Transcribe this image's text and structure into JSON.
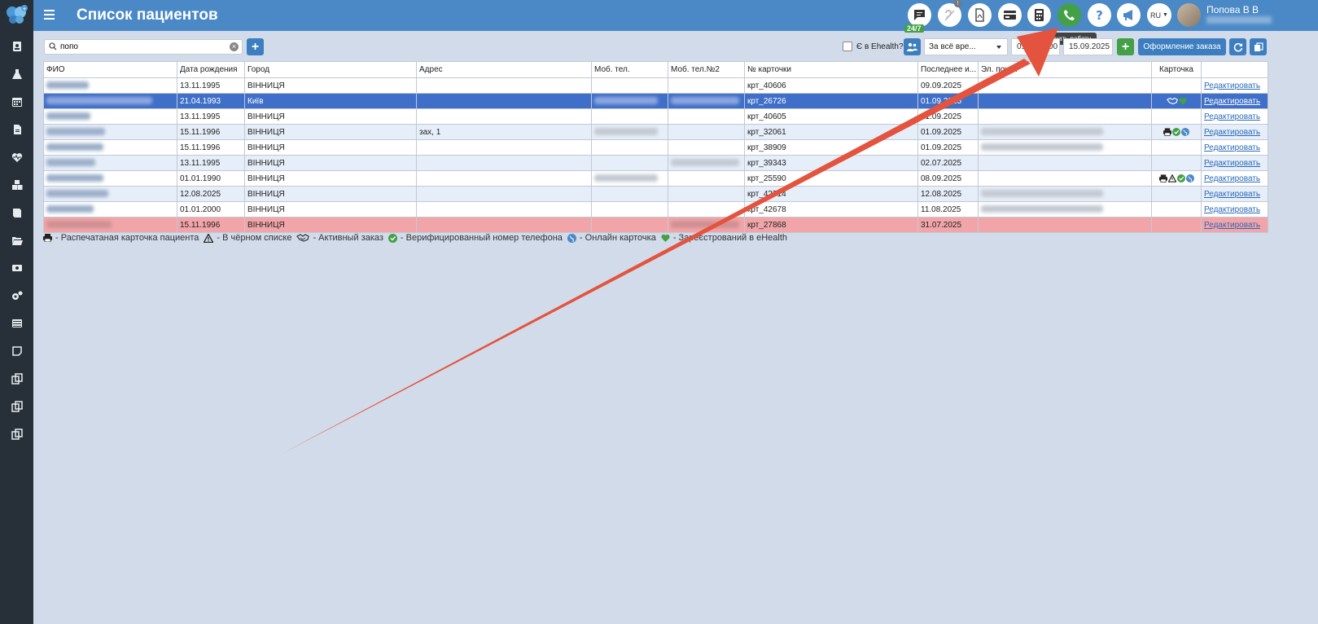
{
  "header": {
    "title": "Список пациентов",
    "badge_247": "24/7",
    "notification_dot": "!",
    "lang": "RU",
    "user_name": "Попова В В",
    "tooltip": "Начать работу"
  },
  "toolbar": {
    "search_value": "попо",
    "ehealth_label": "Є в Ehealth?",
    "period": "За всё вре...",
    "date_from": "01.01.1900",
    "date_to": "15.09.2025",
    "order_button": "Оформление заказа"
  },
  "table": {
    "columns": [
      "ФИО",
      "Дата рождения",
      "Город",
      "Адрес",
      "Моб. тел.",
      "Моб. тел.№2",
      "№ карточки",
      "Последнее и...",
      "Эл. почта",
      "Карточка",
      ""
    ],
    "edit_label": "Редактировать",
    "rows": [
      {
        "dob": "13.11.1995",
        "city": "ВІННИЦЯ",
        "address": "",
        "card": "крт_40606",
        "last": "09.09.2025",
        "icons": []
      },
      {
        "dob": "21.04.1993",
        "city": "Київ",
        "address": "",
        "card": "крт_26726",
        "last": "01.09.2025",
        "icons": [
          "order",
          "ehealth"
        ]
      },
      {
        "dob": "13.11.1995",
        "city": "ВІННИЦЯ",
        "address": "",
        "card": "крт_40605",
        "last": "01.09.2025",
        "icons": []
      },
      {
        "dob": "15.11.1996",
        "city": "ВІННИЦЯ",
        "address": "зах, 1",
        "card": "крт_32061",
        "last": "01.09.2025",
        "icons": [
          "print",
          "verified",
          "online"
        ]
      },
      {
        "dob": "15.11.1996",
        "city": "ВІННИЦЯ",
        "address": "",
        "card": "крт_38909",
        "last": "01.09.2025",
        "icons": []
      },
      {
        "dob": "13.11.1995",
        "city": "ВІННИЦЯ",
        "address": "",
        "card": "крт_39343",
        "last": "02.07.2025",
        "icons": []
      },
      {
        "dob": "01.01.1990",
        "city": "ВІННИЦЯ",
        "address": "",
        "card": "крт_25590",
        "last": "08.09.2025",
        "icons": [
          "print",
          "blacklist",
          "verified",
          "online"
        ]
      },
      {
        "dob": "12.08.2025",
        "city": "ВІННИЦЯ",
        "address": "",
        "card": "крт_42714",
        "last": "12.08.2025",
        "icons": []
      },
      {
        "dob": "01.01.2000",
        "city": "ВІННИЦЯ",
        "address": "",
        "card": "крт_42678",
        "last": "11.08.2025",
        "icons": []
      },
      {
        "dob": "15.11.1996",
        "city": "ВІННИЦЯ",
        "address": "",
        "card": "крт_27868",
        "last": "31.07.2025",
        "icons": []
      }
    ]
  },
  "legend": {
    "print": "- Распечатаная карточка пациента",
    "blacklist": "- В чёрном списке",
    "order": "- Активный заказ",
    "verified": "- Верифицированный номер телефона",
    "online": "- Онлайн карточка",
    "ehealth": "- Зареєстрований в eHealth"
  },
  "colors": {
    "header": "#4b89c6",
    "sidebar": "#273039",
    "background": "#d1dbea",
    "selected_row": "#3f6fc8",
    "blacklist_row": "#f2a5a8",
    "accent_green": "#43a047",
    "annotation_arrow": "#e4533d"
  }
}
